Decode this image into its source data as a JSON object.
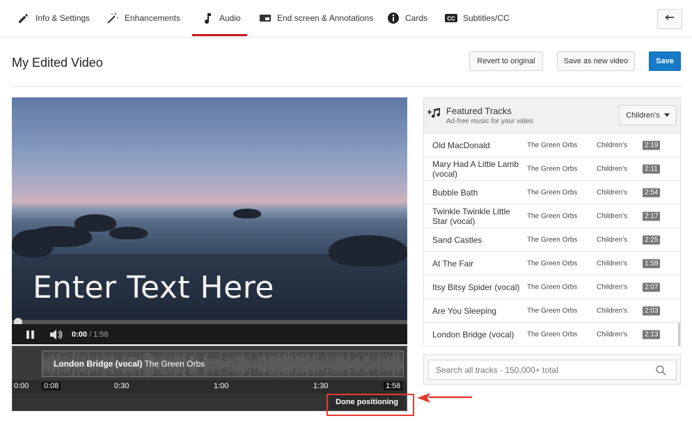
{
  "tabs": [
    {
      "label": "Info & Settings",
      "icon": "pencil-icon"
    },
    {
      "label": "Enhancements",
      "icon": "magic-wand-icon"
    },
    {
      "label": "Audio",
      "icon": "music-note-icon",
      "active": true
    },
    {
      "label": "End screen & Annotations",
      "icon": "end-screen-icon"
    },
    {
      "label": "Cards",
      "icon": "info-icon"
    },
    {
      "label": "Subtitles/CC",
      "icon": "cc-icon"
    }
  ],
  "header": {
    "title": "My Edited Video",
    "revert_label": "Revert to original",
    "save_new_label": "Save as new video",
    "save_label": "Save"
  },
  "player": {
    "overlay_text": "Enter Text Here",
    "current_time": "0:00",
    "separator": " / ",
    "duration": "1:58",
    "progress_fraction": 0.0
  },
  "audio_strip": {
    "track_title": "London Bridge (vocal)",
    "track_artist": "The Green Orbs",
    "ruler": {
      "start": "0:00",
      "offset": "0:08",
      "t30": "0:30",
      "t60": "1:00",
      "t90": "1:30",
      "end": "1:58"
    },
    "done_label": "Done positioning"
  },
  "tracks_panel": {
    "title": "Featured Tracks",
    "subtitle": "Ad-free music for your video",
    "genre_selected": "Children's",
    "tracks": [
      {
        "title": "Old MacDonald",
        "artist": "The Green Orbs",
        "genre": "Children's",
        "duration": "2:19"
      },
      {
        "title": "Mary Had A Little Lamb (vocal)",
        "artist": "The Green Orbs",
        "genre": "Children's",
        "duration": "2:11"
      },
      {
        "title": "Bubble Bath",
        "artist": "The Green Orbs",
        "genre": "Children's",
        "duration": "2:54"
      },
      {
        "title": "Twinkle Twinkle Little Star (vocal)",
        "artist": "The Green Orbs",
        "genre": "Children's",
        "duration": "2:17"
      },
      {
        "title": "Sand Castles",
        "artist": "The Green Orbs",
        "genre": "Children's",
        "duration": "2:25"
      },
      {
        "title": "At The Fair",
        "artist": "The Green Orbs",
        "genre": "Children's",
        "duration": "1:59"
      },
      {
        "title": "Itsy Bitsy Spider (vocal)",
        "artist": "The Green Orbs",
        "genre": "Children's",
        "duration": "2:07"
      },
      {
        "title": "Are You Sleeping",
        "artist": "The Green Orbs",
        "genre": "Children's",
        "duration": "2:03"
      },
      {
        "title": "London Bridge (vocal)",
        "artist": "The Green Orbs",
        "genre": "Children's",
        "duration": "2:13",
        "selected": true
      }
    ]
  },
  "search": {
    "placeholder": "Search all tracks - 150,000+ total"
  },
  "colors": {
    "accent_red": "#cc181e",
    "save_blue": "#167ac6",
    "callout_red": "#e33b2e"
  }
}
